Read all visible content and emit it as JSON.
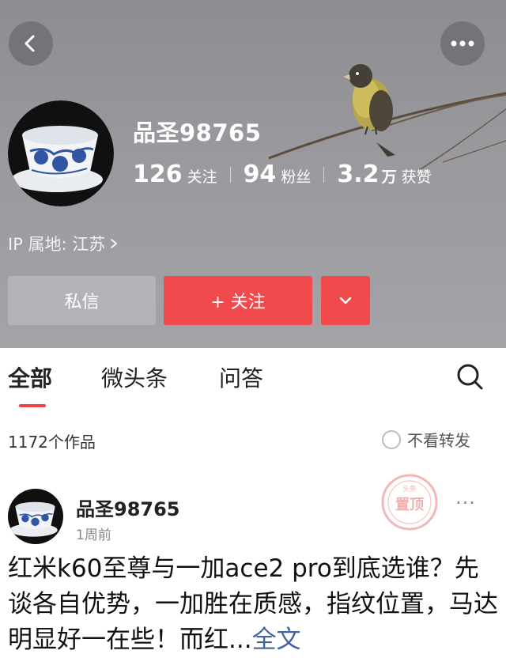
{
  "profile": {
    "username": "品圣98765",
    "stats": [
      {
        "value": "126",
        "unit": "",
        "label": "关注"
      },
      {
        "value": "94",
        "unit": "",
        "label": "粉丝"
      },
      {
        "value": "3.2",
        "unit": "万",
        "label": "获赞"
      }
    ],
    "ip_location": "IP 属地: 江苏"
  },
  "actions": {
    "message_label": "私信",
    "follow_label": "+ 关注"
  },
  "tabs": [
    {
      "label": "全部",
      "active": true
    },
    {
      "label": "微头条",
      "active": false
    },
    {
      "label": "问答",
      "active": false
    }
  ],
  "list_header": {
    "works_count": "1172个作品",
    "hide_reposts_label": "不看转发"
  },
  "post": {
    "author": "品圣98765",
    "time": "1周前",
    "stamp_text": "置顶",
    "stamp_small": "头条",
    "text": "红米k60至尊与一加ace2 pro到底选谁？先谈各自优势，一加胜在质感，指纹位置，马达明显好一在些！而红...",
    "full_text_link": "全文"
  },
  "icons": {
    "back": "chevron-left-icon",
    "more": "more-dots-icon",
    "dropdown": "chevron-down-icon",
    "search": "search-icon"
  },
  "colors": {
    "accent": "#f14a4d",
    "link": "#406599",
    "header_bg": "#9a999e"
  }
}
